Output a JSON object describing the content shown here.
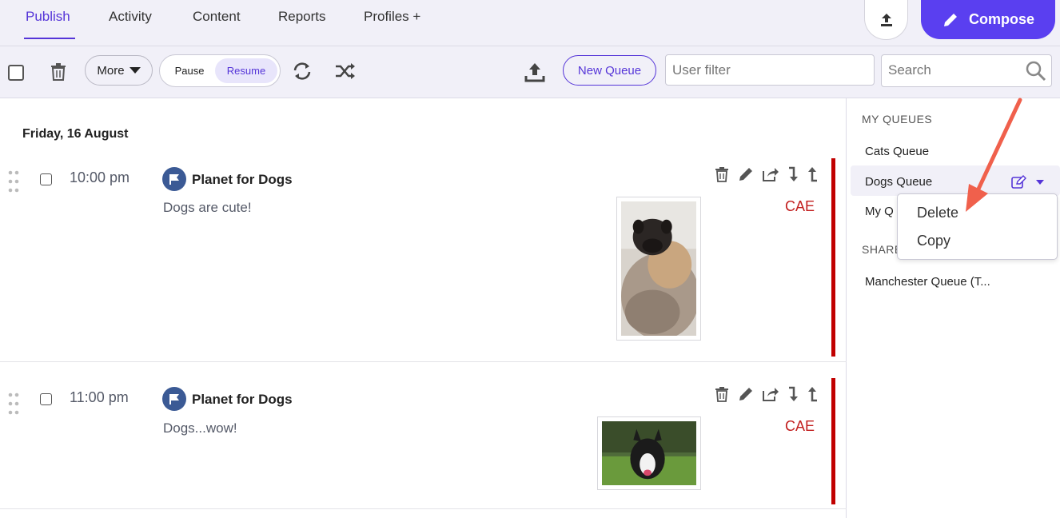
{
  "nav": {
    "tabs": [
      "Publish",
      "Activity",
      "Content",
      "Reports",
      "Profiles +"
    ],
    "compose_label": "Compose"
  },
  "toolbar": {
    "more_label": "More",
    "pause_label": "Pause",
    "resume_label": "Resume",
    "new_queue_label": "New Queue",
    "user_filter_placeholder": "User filter",
    "search_placeholder": "Search"
  },
  "main": {
    "date_header": "Friday, 16 August",
    "posts": [
      {
        "time": "10:00 pm",
        "profile": "Planet for Dogs",
        "text": "Dogs are cute!",
        "label": "CAE"
      },
      {
        "time": "11:00 pm",
        "profile": "Planet for Dogs",
        "text": "Dogs...wow!",
        "label": "CAE"
      }
    ]
  },
  "sidebar": {
    "my_queues_heading": "MY QUEUES",
    "my_queues": [
      "Cats Queue",
      "Dogs Queue",
      "My Q"
    ],
    "shared_heading": "SHARE",
    "shared_queues": [
      "Manchester Queue (T..."
    ]
  },
  "dropdown": {
    "items": [
      "Delete",
      "Copy"
    ]
  },
  "colors": {
    "accent": "#5535d8",
    "compose": "#5a3ff0",
    "status_bar": "#c10000",
    "label_red": "#c21e1e"
  }
}
